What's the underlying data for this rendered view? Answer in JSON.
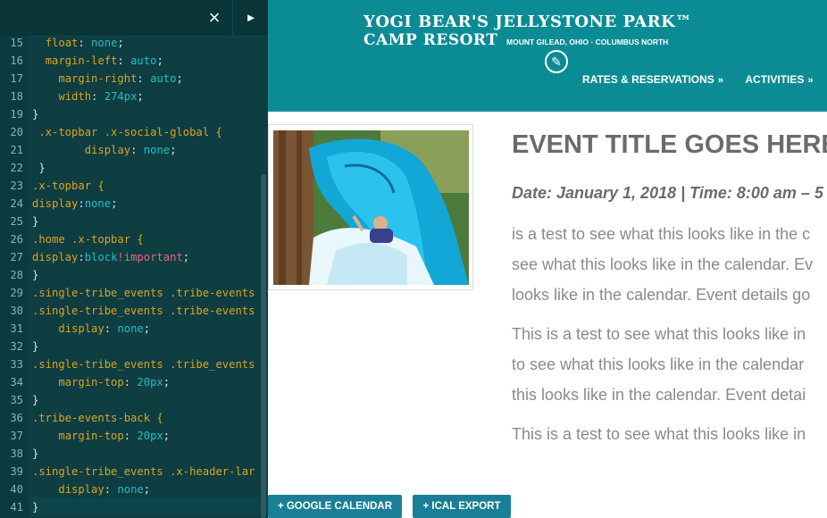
{
  "editor": {
    "close_icon": "×",
    "run_icon": "►",
    "lines": [
      {
        "n": "15",
        "src": "  float: none;"
      },
      {
        "n": "16",
        "src": "  margin-left: auto;"
      },
      {
        "n": "17",
        "src": "    margin-right: auto;"
      },
      {
        "n": "18",
        "src": "    width: 274px;"
      },
      {
        "n": "19",
        "src": "}"
      },
      {
        "n": "20",
        "src": " .x-topbar .x-social-global {"
      },
      {
        "n": "21",
        "src": "        display: none;"
      },
      {
        "n": "22",
        "src": " }"
      },
      {
        "n": "23",
        "src": ".x-topbar {"
      },
      {
        "n": "24",
        "src": "display:none;"
      },
      {
        "n": "25",
        "src": "}"
      },
      {
        "n": "26",
        "src": ".home .x-topbar {"
      },
      {
        "n": "27",
        "src": "display:block!important;"
      },
      {
        "n": "28",
        "src": "}"
      },
      {
        "n": "29",
        "src": ".single-tribe_events .tribe-events"
      },
      {
        "n": "30",
        "src": ".single-tribe_events .tribe-events"
      },
      {
        "n": "31",
        "src": "    display: none;"
      },
      {
        "n": "32",
        "src": "}"
      },
      {
        "n": "33",
        "src": ".single-tribe_events .tribe_events"
      },
      {
        "n": "34",
        "src": "    margin-top: 20px;"
      },
      {
        "n": "35",
        "src": "}"
      },
      {
        "n": "36",
        "src": ".tribe-events-back {"
      },
      {
        "n": "37",
        "src": "    margin-top: 20px;"
      },
      {
        "n": "38",
        "src": "}"
      },
      {
        "n": "39",
        "src": ".single-tribe_events .x-header-lar"
      },
      {
        "n": "40",
        "src": "    display: none;"
      },
      {
        "n": "41",
        "src": "}"
      }
    ]
  },
  "header": {
    "logo_line1": "YOGI BEAR'S JELLYSTONE PARK™",
    "logo_line2": "CAMP RESORT",
    "logo_sub": "MOUNT GILEAD, OHIO · COLUMBUS NORTH",
    "edit_icon": "✎",
    "nav": [
      {
        "label": "RATES & RESERVATIONS",
        "chevron": "»"
      },
      {
        "label": "ACTIVITIES",
        "chevron": "»"
      }
    ]
  },
  "event": {
    "title": "EVENT TITLE GOES HERE",
    "meta": "Date: January 1, 2018  |  Time: 8:00 am – 5",
    "p1": [
      "is a test to see what this looks like in the c",
      "see what this looks like in the calendar. Ev",
      "looks like in the calendar. Event details go"
    ],
    "p2": [
      "This is a test to see what this looks like in",
      "to see what this looks like in the calendar",
      "this looks like in the calendar. Event detai"
    ],
    "p3": [
      "This is a test to see what this looks like in"
    ]
  },
  "buttons": {
    "google": "+ GOOGLE CALENDAR",
    "ical": "+ ICAL EXPORT"
  },
  "colors": {
    "header_teal": "#0b8c94",
    "editor_bg": "#0e3d42",
    "button_blue": "#1a7f96"
  }
}
